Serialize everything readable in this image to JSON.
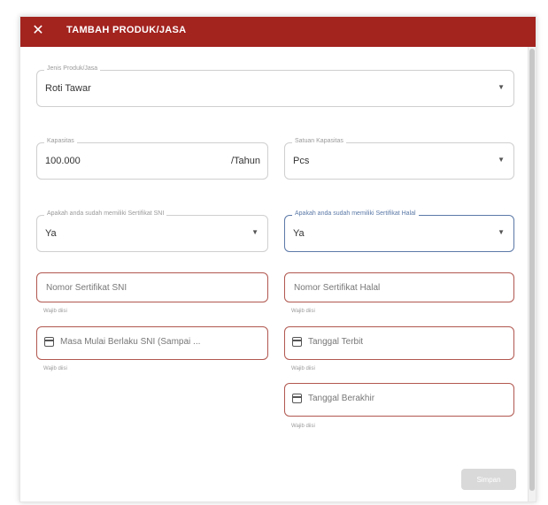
{
  "dialog": {
    "title": "TAMBAH PRODUK/JASA",
    "close_icon": "close-icon"
  },
  "form": {
    "jenis_produk": {
      "label": "Jenis Produk/Jasa",
      "value": "Roti Tawar"
    },
    "kapasitas": {
      "label": "Kapasitas",
      "value": "100.000",
      "suffix": "/Tahun"
    },
    "satuan_kapasitas": {
      "label": "Satuan Kapasitas",
      "value": "Pcs"
    },
    "sertifikat_sni": {
      "label": "Apakah anda sudah memiliki Sertifikat SNI",
      "value": "Ya"
    },
    "sertifikat_halal": {
      "label": "Apakah anda sudah memiliki Sertifikat Halal",
      "value": "Ya"
    },
    "nomor_sni": {
      "placeholder": "Nomor Sertifikat SNI",
      "helper": "Wajib diisi"
    },
    "nomor_halal": {
      "placeholder": "Nomor Sertifikat Halal",
      "helper": "Wajib diisi"
    },
    "masa_sni": {
      "placeholder": "Masa Mulai Berlaku SNI (Sampai ...",
      "helper": "Wajib diisi"
    },
    "tanggal_terbit": {
      "placeholder": "Tanggal Terbit",
      "helper": "Wajib diisi"
    },
    "tanggal_berakhir": {
      "placeholder": "Tanggal Berakhir",
      "helper": "Wajib diisi"
    }
  },
  "actions": {
    "submit_label": "Simpan"
  },
  "colors": {
    "header": "#a3231f",
    "error_border": "#b1574f",
    "focus_border": "#5b79a7"
  }
}
